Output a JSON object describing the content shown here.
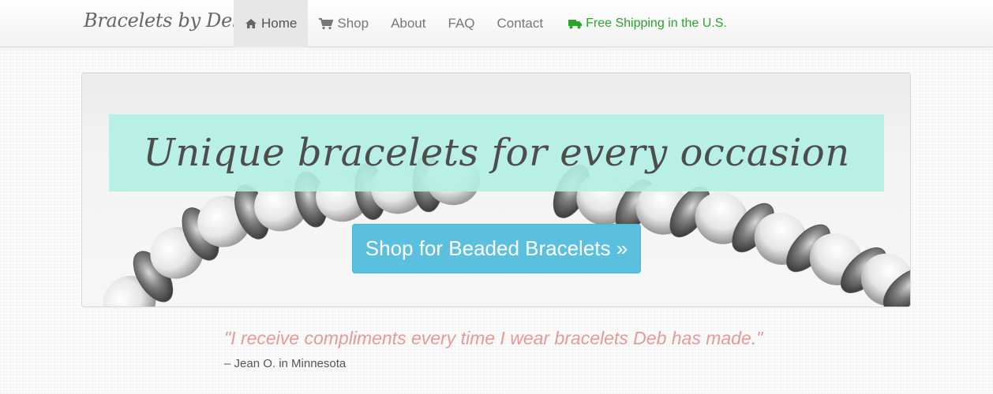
{
  "navbar": {
    "brand": "Bracelets by Deb",
    "items": [
      {
        "label": "Home",
        "icon": "home-icon",
        "active": true
      },
      {
        "label": "Shop",
        "icon": "cart-icon"
      },
      {
        "label": "About"
      },
      {
        "label": "FAQ"
      },
      {
        "label": "Contact"
      }
    ],
    "shipping": {
      "label": "Free Shipping in the U.S.",
      "icon": "truck-icon",
      "color": "#2aa52a"
    }
  },
  "hero": {
    "tagline": "Unique bracelets for every occasion",
    "cta_label": "Shop for Beaded Bracelets »",
    "band_color": "#b2f0e4",
    "cta_color": "#5bc0de"
  },
  "testimonial": {
    "quote": "\"I receive compliments every time I wear bracelets Deb has made.\"",
    "attribution": "– Jean O. in Minnesota",
    "quote_color": "#e59a9a"
  }
}
